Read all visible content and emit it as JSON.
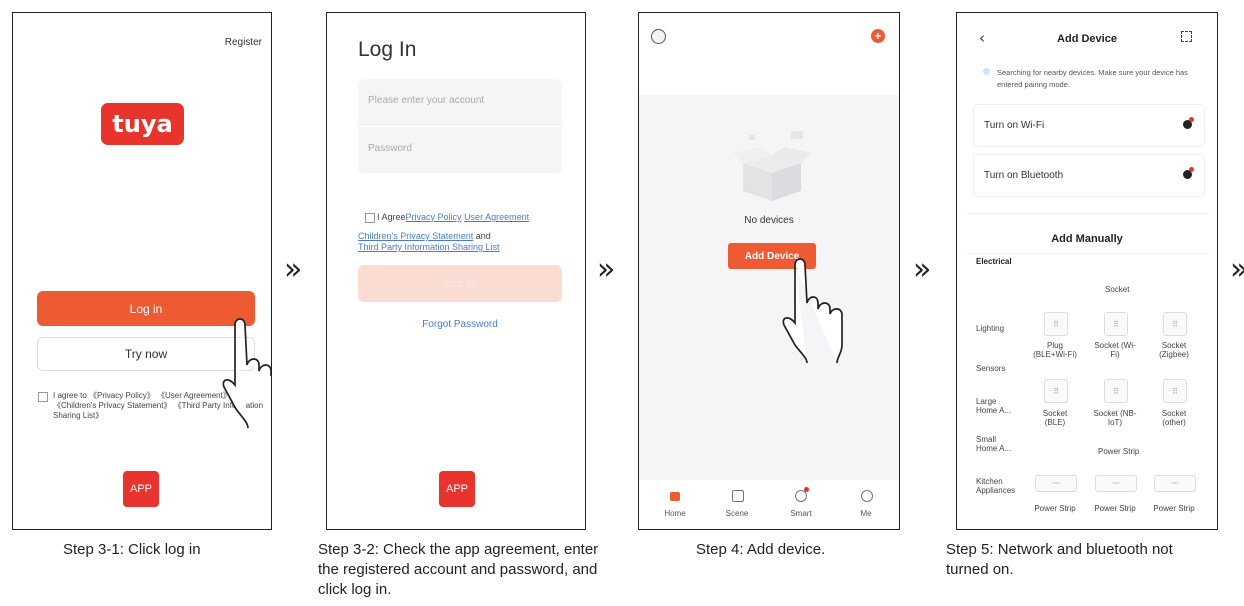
{
  "colors": {
    "accent": "#ee5a32",
    "brand": "#e8342c",
    "link": "#4a7bd0"
  },
  "screen1": {
    "register": "Register",
    "logo": "tuya",
    "login_button": "Log in",
    "try_now_button": "Try now",
    "agree_text": "I agree to 《Privacy Policy》 《User Agreement》 《Children's Privacy Statement》 《Third Party Information Sharing List》",
    "app_badge": "APP"
  },
  "screen2": {
    "title": "Log In",
    "account_placeholder": "Please enter your account",
    "password_placeholder": "Password",
    "agree_prefix": "I Agree",
    "privacy_policy": "Privacy Policy",
    "user_agreement": "User Agreement",
    "children_privacy": "Children's Privacy Statement",
    "and": "and",
    "third_party": "Third Party Information Sharing List",
    "login_button": "Log In",
    "forgot_password": "Forgot Password",
    "app_badge": "APP"
  },
  "screen3": {
    "no_devices": "No devices",
    "add_device_button": "Add Device",
    "tabs": [
      {
        "label": "Home",
        "icon": "home-icon"
      },
      {
        "label": "Scene",
        "icon": "scene-icon"
      },
      {
        "label": "Smart",
        "icon": "smart-icon"
      },
      {
        "label": "Me",
        "icon": "me-icon"
      }
    ]
  },
  "screen4": {
    "title": "Add Device",
    "searching_text": "Searching for nearby devices. Make sure your device has entered pairing mode.",
    "wifi_row": "Turn on Wi-Fi",
    "bluetooth_row": "Turn on Bluetooth",
    "add_manually": "Add Manually",
    "categories": [
      "Electrical",
      "Lighting",
      "Sensors",
      "Large Home A...",
      "Small Home A...",
      "Kitchen Appliances"
    ],
    "socket_header": "Socket",
    "devices_row1": [
      "Plug (BLE+Wi-Fi)",
      "Socket (Wi-Fi)",
      "Socket (Zigbee)"
    ],
    "devices_row2": [
      "Socket (BLE)",
      "Socket (NB-IoT)",
      "Socket (other)"
    ],
    "power_strip_header": "Power Strip",
    "strip_labels": [
      "Power Strip",
      "Power Strip",
      "Power Strip"
    ]
  },
  "captions": {
    "step1": "Step 3-1: Click log in",
    "step2": "Step 3-2: Check the app agreement, enter the registered account and password, and click log in.",
    "step3": "Step 4: Add device.",
    "step4": "Step 5: Network and bluetooth not turned on."
  },
  "arrows": [
    "»",
    "»",
    "»",
    "»"
  ]
}
